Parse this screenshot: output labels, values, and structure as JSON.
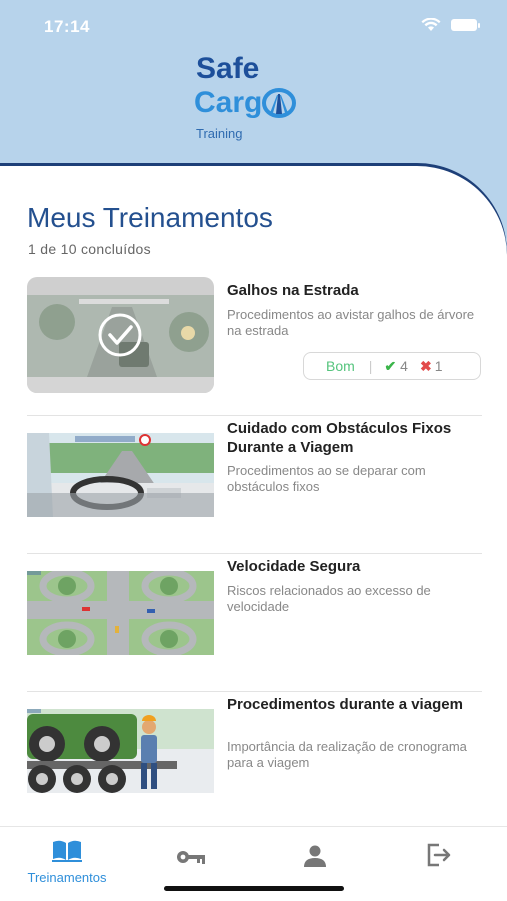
{
  "status": {
    "time": "17:14"
  },
  "logo": {
    "safe": "Safe",
    "cargo": "Carg",
    "training": "Training"
  },
  "page": {
    "title": "Meus Treinamentos",
    "subtitle": "1 de 10 concluídos"
  },
  "trainings": [
    {
      "title": "Galhos na Estrada",
      "description": "Procedimentos ao avistar galhos de árvore na estrada",
      "completed": true,
      "rating": {
        "grade": "Bom",
        "correct": "4",
        "wrong": "1"
      }
    },
    {
      "title": "Cuidado com Obstáculos Fixos Durante a Viagem",
      "description": "Procedimentos ao se deparar com obstáculos fixos"
    },
    {
      "title": "Velocidade Segura",
      "description": "Riscos relacionados ao excesso de velocidade"
    },
    {
      "title": "Procedimentos durante a viagem",
      "description": "Importância da realização de cronograma para a viagem"
    }
  ],
  "tabs": [
    {
      "label": "Treinamentos",
      "icon": "book-icon",
      "active": true
    },
    {
      "icon": "key-icon"
    },
    {
      "icon": "person-icon"
    },
    {
      "icon": "logout-icon"
    }
  ],
  "colors": {
    "header_bg": "#b7d3eb",
    "brand_dark": "#1d4f9a",
    "brand_light": "#2f8fda",
    "good": "#55c47d",
    "bad": "#e24a4a"
  }
}
